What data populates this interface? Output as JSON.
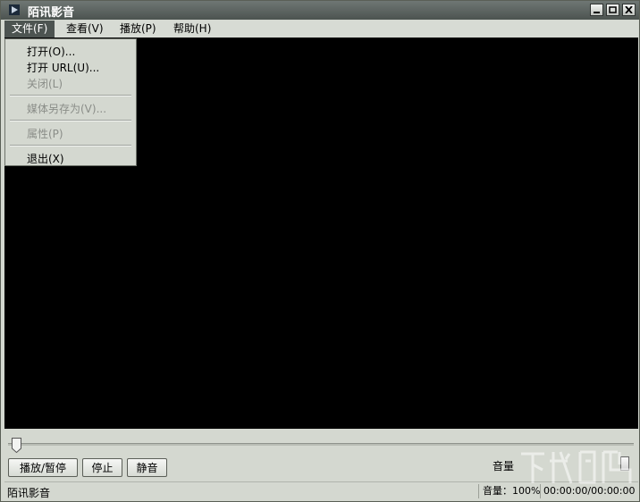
{
  "window": {
    "title": "陌讯影音"
  },
  "menubar": [
    {
      "label": "文件(F)"
    },
    {
      "label": "查看(V)"
    },
    {
      "label": "播放(P)"
    },
    {
      "label": "帮助(H)"
    }
  ],
  "file_menu": {
    "items": [
      {
        "label": "打开(O)...",
        "enabled": true
      },
      {
        "label": "打开 URL(U)...",
        "enabled": true
      },
      {
        "label": "关闭(L)",
        "enabled": false
      },
      {
        "label": "媒体另存为(V)...",
        "enabled": false
      },
      {
        "label": "属性(P)",
        "enabled": false
      },
      {
        "label": "退出(X)",
        "enabled": true
      }
    ]
  },
  "controls": {
    "play_pause": "播放/暂停",
    "stop": "停止",
    "mute": "静音",
    "volume_label": "音量"
  },
  "status": {
    "app_name": "陌讯影音",
    "volume": "音量：100%",
    "time": "00:00:00/00:00:00"
  },
  "colors": {
    "active_menu": "#4d5451",
    "video_bg": "#000000",
    "disabled_text": "#8a8d88"
  }
}
